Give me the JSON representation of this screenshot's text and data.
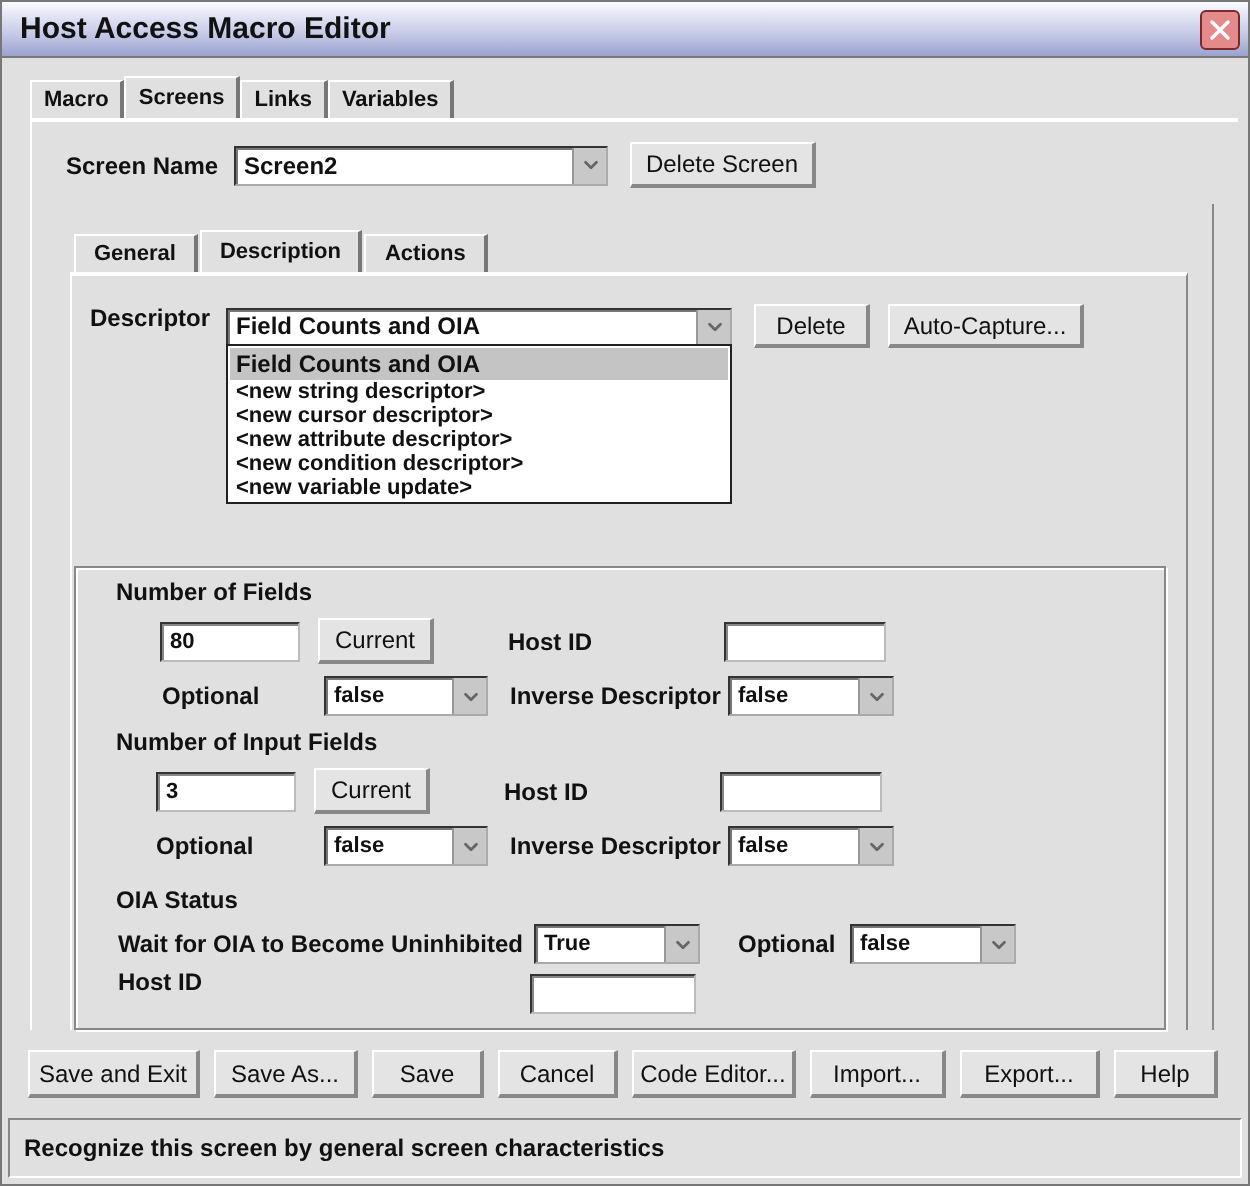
{
  "window": {
    "title": "Host Access Macro Editor"
  },
  "tabs": [
    {
      "label": "Macro",
      "selected": false
    },
    {
      "label": "Screens",
      "selected": true
    },
    {
      "label": "Links",
      "selected": false
    },
    {
      "label": "Variables",
      "selected": false
    }
  ],
  "screen_name": {
    "label": "Screen Name",
    "value": "Screen2",
    "button": "Delete Screen"
  },
  "inner_tabs": [
    {
      "label": "General",
      "selected": false
    },
    {
      "label": "Description",
      "selected": true
    },
    {
      "label": "Actions",
      "selected": false
    }
  ],
  "descriptor": {
    "label": "Descriptor",
    "value": "Field Counts and OIA",
    "buttons": [
      "Delete",
      "Auto-Capture..."
    ],
    "expanded": true,
    "options": [
      {
        "label": "Field Counts and OIA",
        "selected": true
      },
      {
        "label": "<new string descriptor>",
        "selected": false
      },
      {
        "label": "<new cursor descriptor>",
        "selected": false
      },
      {
        "label": "<new attribute descriptor>",
        "selected": false
      },
      {
        "label": "<new condition descriptor>",
        "selected": false
      },
      {
        "label": "<new variable update>",
        "selected": false
      }
    ]
  },
  "field_sections": [
    {
      "title": "Number of Fields",
      "value": "80",
      "button": "Current",
      "host_id_label": "Host ID",
      "optional_label": "Optional",
      "optional_value": "false",
      "inverse_label": "Inverse Descriptor",
      "inverse_value": "false"
    },
    {
      "title": "Number of Input Fields",
      "value": "3",
      "button": "Current",
      "host_id_label": "Host ID",
      "optional_label": "Optional",
      "optional_value": "false",
      "inverse_label": "Inverse Descriptor",
      "inverse_value": "false"
    }
  ],
  "oia_status": {
    "title": "OIA Status",
    "wait_label": "Wait for OIA to Become Uninhibited",
    "wait_value": "True",
    "optional_label": "Optional",
    "optional_value": "false",
    "host_id_label": "Host ID"
  },
  "footer_buttons": [
    "Save and Exit",
    "Save As...",
    "Save",
    "Cancel",
    "Code Editor...",
    "Import...",
    "Export...",
    "Help"
  ],
  "status_bar": "Recognize this screen by general screen characteristics"
}
